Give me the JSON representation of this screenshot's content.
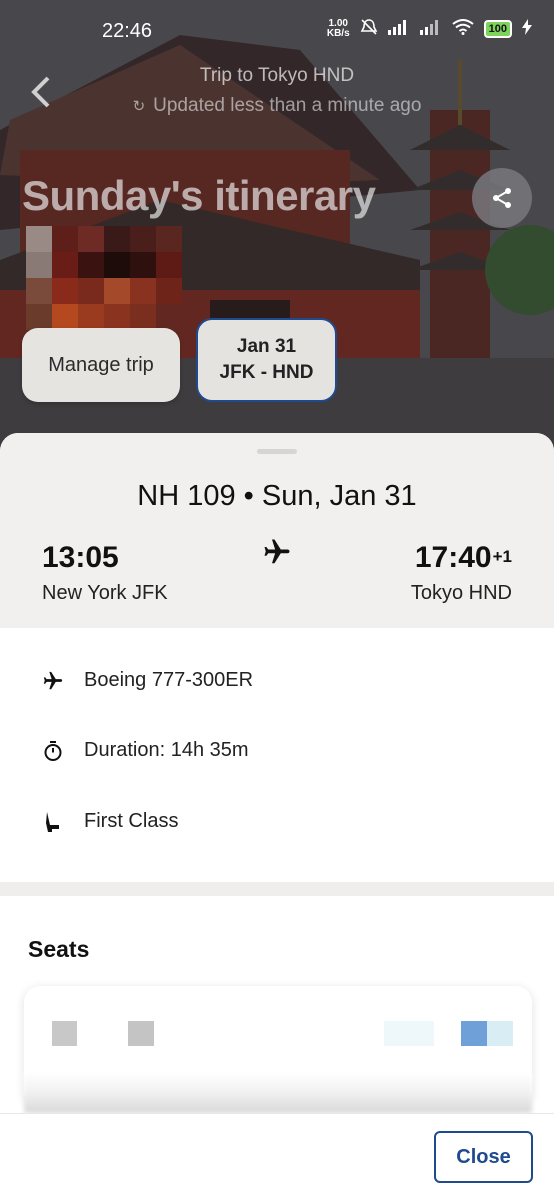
{
  "status_bar": {
    "time": "22:46",
    "net_speed_value": "1.00",
    "net_speed_unit": "KB/s",
    "battery": "100"
  },
  "header": {
    "trip_title": "Trip to Tokyo HND",
    "updated_text": "Updated less than a minute ago",
    "itinerary_title": "Sunday's itinerary"
  },
  "chips": {
    "manage_label": "Manage trip",
    "date_label": "Jan 31",
    "route_label": "JFK - HND"
  },
  "flight": {
    "heading": "NH 109 • Sun, Jan 31",
    "departure_time": "13:05",
    "departure_city": "New York JFK",
    "arrival_time": "17:40",
    "arrival_day_offset": "+1",
    "arrival_city": "Tokyo HND"
  },
  "details": {
    "aircraft": "Boeing 777-300ER",
    "duration": "Duration: 14h 35m",
    "cabin": "First Class"
  },
  "seats": {
    "title": "Seats"
  },
  "footer": {
    "close_label": "Close"
  },
  "colors": {
    "accent": "#1f4a8e",
    "sheet_top_bg": "#f1f0ee",
    "battery_green": "#7dd35b"
  },
  "icons": {
    "back": "back-arrow-icon",
    "share": "share-icon",
    "plane": "airplane-icon",
    "timer": "stopwatch-icon",
    "seat": "seat-icon"
  }
}
